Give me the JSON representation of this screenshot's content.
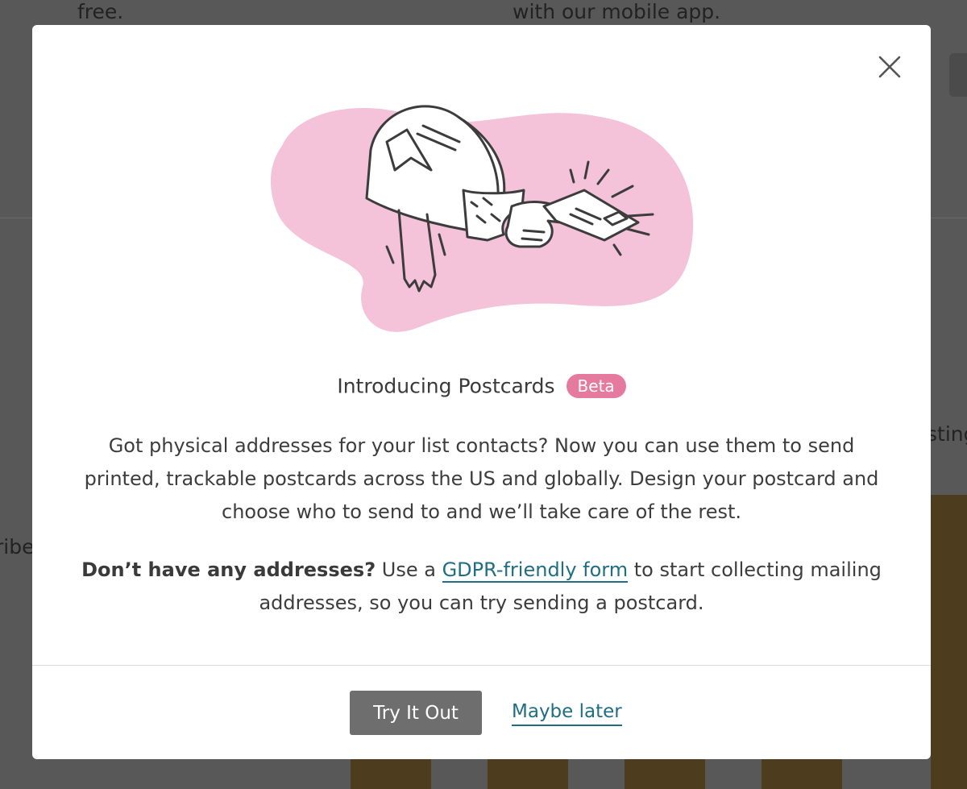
{
  "background": {
    "fragments": {
      "free": "free.",
      "mobile_app": "with our mobile app.",
      "right_fragment": "sting",
      "left_fragment": "ribe"
    }
  },
  "modal": {
    "title": "Introducing Postcards",
    "badge": "Beta",
    "paragraph1": "Got physical addresses for your list contacts? Now you can use them to send printed, trackable postcards across the US and globally. Design your postcard and choose who to send to and we’ll take care of the rest.",
    "paragraph2_bold": "Don’t have any addresses?",
    "paragraph2_pre": " Use a ",
    "paragraph2_link": "GDPR-friendly form",
    "paragraph2_post": " to start collecting mailing addresses, so you can try sending a postcard.",
    "primary_button": "Try It Out",
    "secondary_link": "Maybe later"
  },
  "colors": {
    "badge": "#e6799e",
    "blob": "#f4c2d9",
    "link": "#1f6e84",
    "button": "#6e6e6e",
    "overlay": "#585858"
  }
}
